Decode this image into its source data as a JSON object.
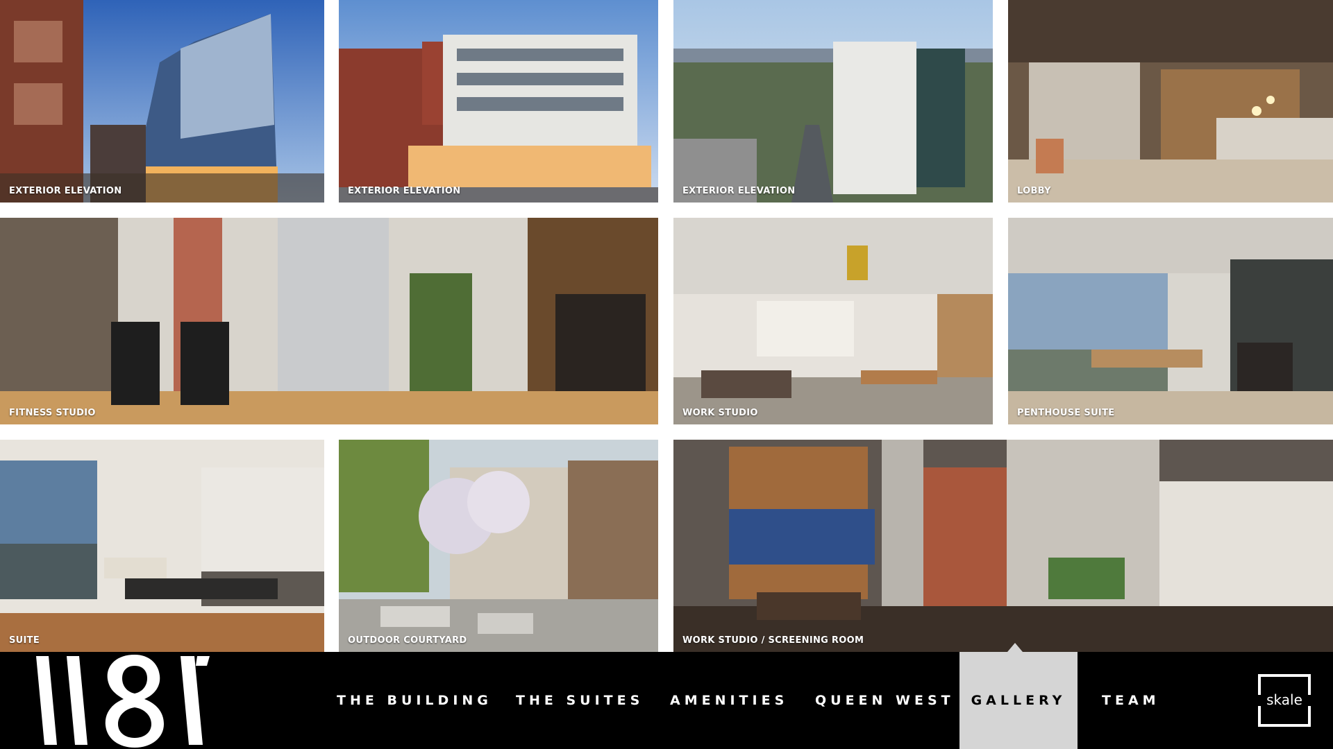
{
  "gallery": {
    "tiles": [
      {
        "caption": "EXTERIOR ELEVATION"
      },
      {
        "caption": "EXTERIOR ELEVATION"
      },
      {
        "caption": "EXTERIOR ELEVATION"
      },
      {
        "caption": "LOBBY"
      },
      {
        "caption": "FITNESS STUDIO"
      },
      {
        "caption": "WORK STUDIO"
      },
      {
        "caption": "PENTHOUSE SUITE"
      },
      {
        "caption": "SUITE"
      },
      {
        "caption": "OUTDOOR COURTYARD"
      },
      {
        "caption": "WORK STUDIO / SCREENING ROOM"
      }
    ]
  },
  "nav": {
    "logo_text": "1181",
    "items": [
      {
        "label": "THE BUILDING"
      },
      {
        "label": "THE SUITES"
      },
      {
        "label": "AMENITIES"
      },
      {
        "label": "QUEEN WEST"
      },
      {
        "label": "GALLERY"
      },
      {
        "label": "TEAM"
      }
    ],
    "active": "GALLERY",
    "brand": "skale"
  },
  "colors": {
    "nav_background": "#000000",
    "active_tab": "#d5d5d5",
    "page_background": "#ffffff"
  }
}
